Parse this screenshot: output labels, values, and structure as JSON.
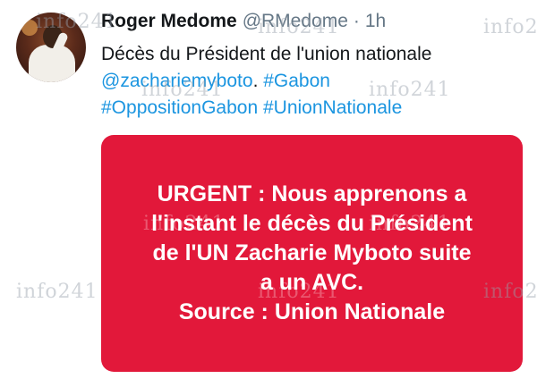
{
  "tweet": {
    "author": {
      "display_name": "Roger Medome",
      "handle": "@RMedome",
      "separator": "·",
      "time": "1h"
    },
    "text": {
      "line1": "Décès du Président de l'union nationale",
      "mention": "@zachariemyboto",
      "period": ". ",
      "hashtag1": "#Gabon",
      "hashtag2": "#OppositionGabon",
      "hashtag3": "#UnionNationale"
    },
    "media": {
      "background_color": "#e2183a",
      "lines": [
        "URGENT : Nous apprenons a",
        "l'instant le décès du Président",
        "de l'UN Zacharie Myboto suite",
        "a un AVC.",
        "Source : Union Nationale"
      ]
    }
  },
  "watermark": "info241"
}
